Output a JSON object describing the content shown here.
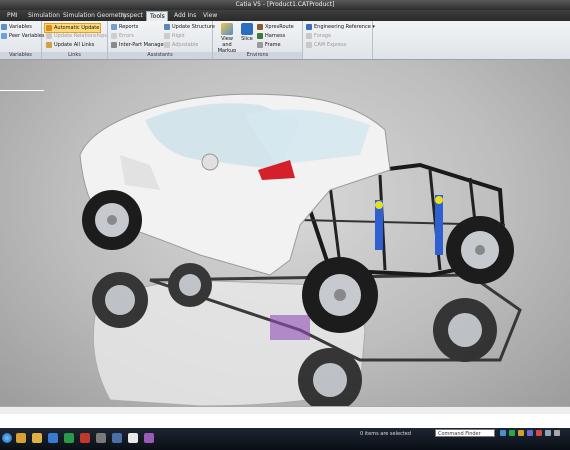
{
  "window": {
    "title": "Catia V5 - [Product1.CATProduct]"
  },
  "tabs": [
    {
      "label": "PMI"
    },
    {
      "label": "Simulation"
    },
    {
      "label": "Simulation Geometry"
    },
    {
      "label": "Inspect"
    },
    {
      "label": "Tools",
      "active": true
    },
    {
      "label": "Add Ins"
    },
    {
      "label": "View"
    }
  ],
  "ribbon": {
    "variables_group": {
      "caption": "Variables",
      "items": [
        "Variables",
        "Peer Variables"
      ]
    },
    "links_group": {
      "caption": "Links",
      "items": [
        "Automatic Update",
        "Update Relationships",
        "Update All Links"
      ]
    },
    "assistants_group": {
      "caption": "Assistants",
      "items_col1": [
        "Reports",
        "Errors",
        "Inter-Part Manager"
      ],
      "items_col2": [
        "Update Structure",
        "Rigid",
        "Adjustable"
      ]
    },
    "environs_group": {
      "caption": "Environs",
      "big": [
        "View and Markup",
        "XpresRoute"
      ],
      "big_short": [
        "View and",
        "Markup",
        "Slice"
      ],
      "items": [
        "XpresRoute",
        "Harness",
        "Frame"
      ]
    },
    "engineering_group": {
      "items": [
        "Engineering Reference",
        "Forage",
        "CAM Express"
      ]
    }
  },
  "statusbar": {
    "selection": "0 items are selected",
    "command_finder": "Command Finder"
  },
  "colors": {
    "ribbon_bg": "#e6e9ed",
    "highlight": "#ffd97a",
    "titlebar": "#3a3a3a",
    "viewport": "#c8c8c8"
  }
}
